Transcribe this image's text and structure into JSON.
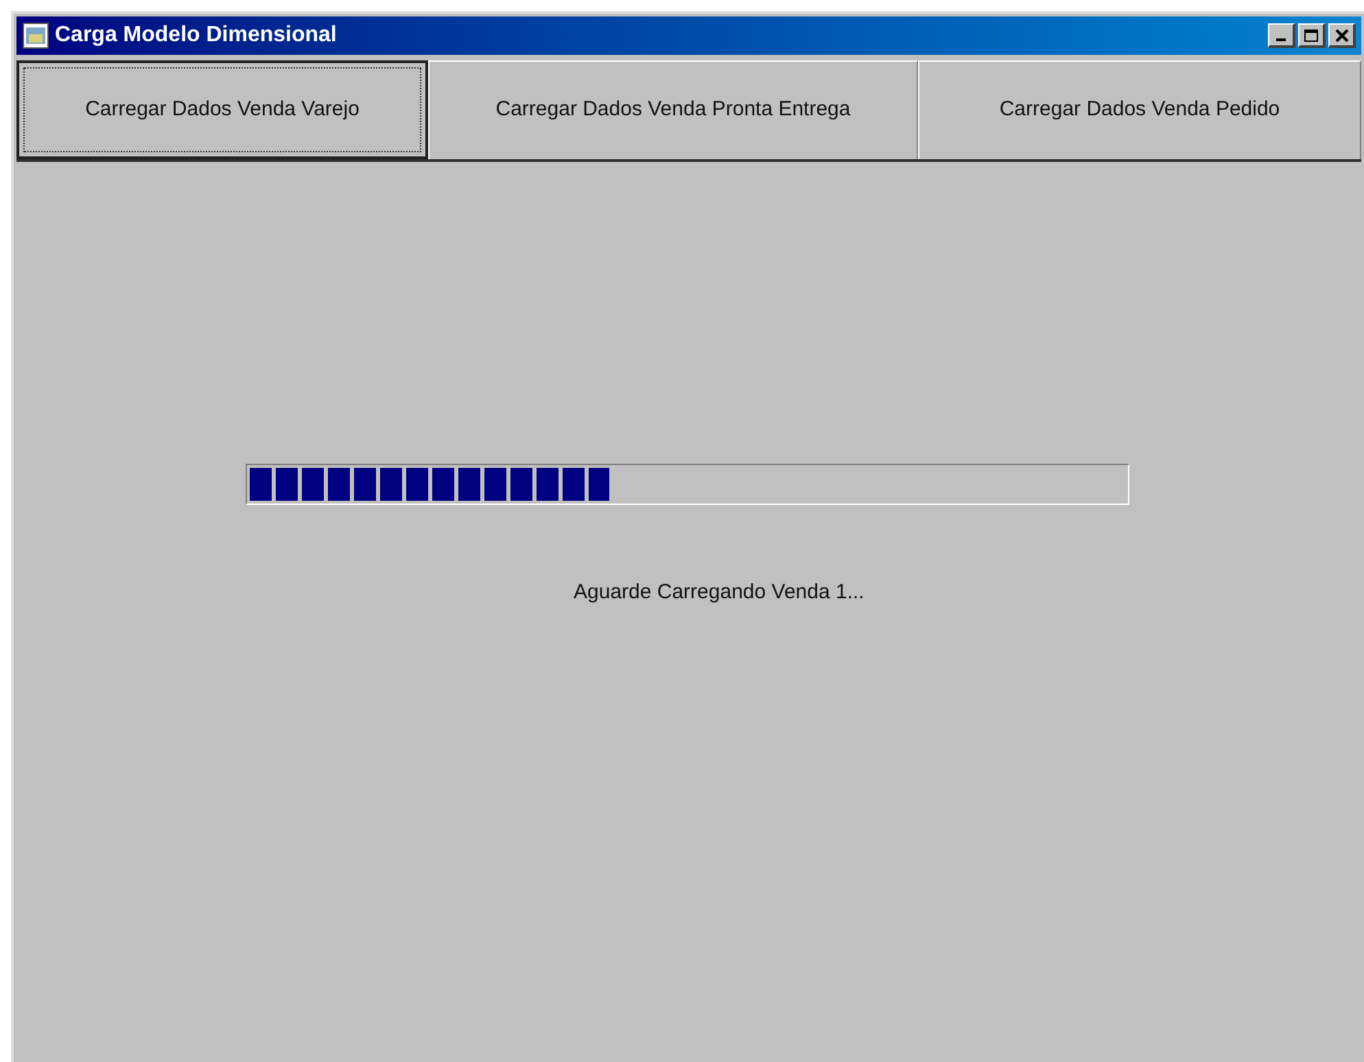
{
  "window": {
    "title": "Carga Modelo Dimensional"
  },
  "buttons": [
    {
      "label": "Carregar Dados Venda Varejo",
      "selected": true
    },
    {
      "label": "Carregar Dados Venda Pronta Entrega",
      "selected": false
    },
    {
      "label": "Carregar Dados Venda Pedido",
      "selected": false
    }
  ],
  "progress": {
    "level": 0.41
  },
  "status": "Aguarde Carregando Venda 1..."
}
